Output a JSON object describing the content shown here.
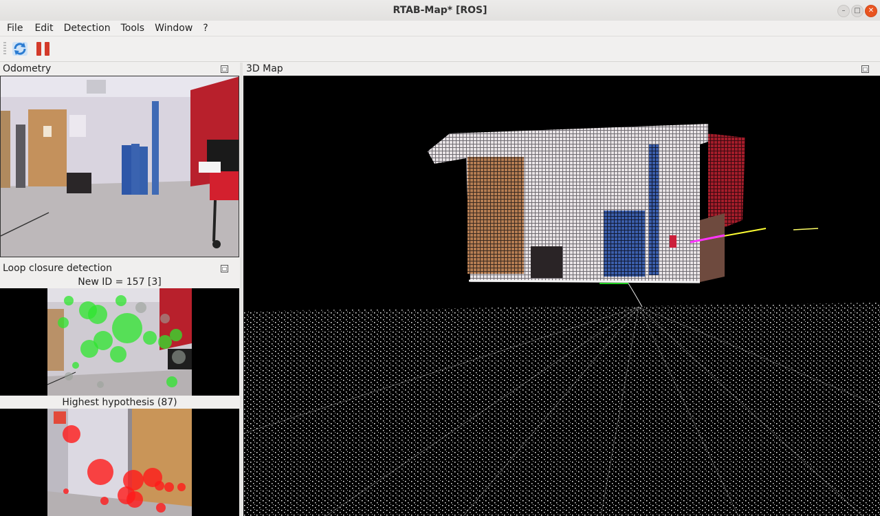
{
  "window": {
    "title": "RTAB-Map* [ROS]"
  },
  "menu": [
    "File",
    "Edit",
    "Detection",
    "Tools",
    "Window",
    "?"
  ],
  "toolbar": {
    "items": [
      "refresh-icon",
      "pause-icon"
    ],
    "refresh_color": "#2a7bd1",
    "pause_color": "#d33a2a"
  },
  "docks": {
    "odometry": {
      "title": "Odometry"
    },
    "loop": {
      "title": "Loop closure detection",
      "new_id_caption": "New ID = 157 [3]",
      "hypothesis_caption": "Highest hypothesis (87)"
    },
    "map3d": {
      "title": "3D Map"
    }
  },
  "colors": {
    "feature_new": "#2ee62e",
    "feature_hyp": "#ff1a1a",
    "map_bg": "#000000",
    "wall_red": "#b8202c"
  }
}
